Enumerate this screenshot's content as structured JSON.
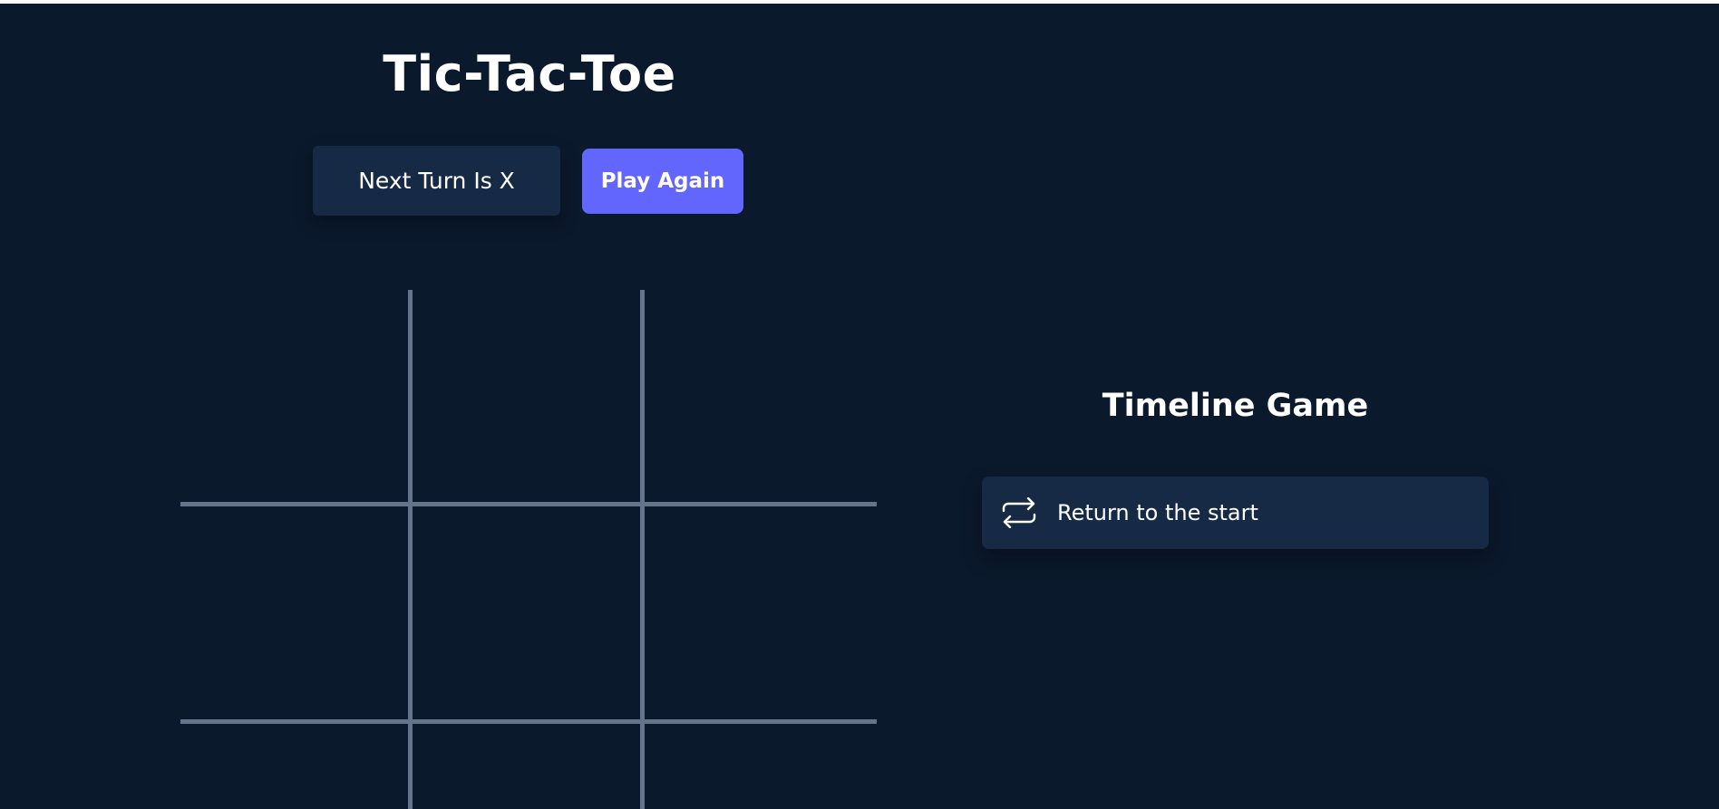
{
  "header": {
    "title": "Tic-Tac-Toe"
  },
  "status": {
    "next_turn_text": "Next Turn Is X"
  },
  "controls": {
    "play_again_label": "Play Again"
  },
  "board": {
    "cells": [
      "",
      "",
      "",
      "",
      "",
      "",
      "",
      "",
      ""
    ]
  },
  "timeline": {
    "title": "Timeline Game",
    "items": [
      {
        "label": "Return to the start",
        "icon": "repeat-icon"
      }
    ]
  },
  "colors": {
    "background": "#0b192c",
    "panel": "#172a45",
    "accent": "#6366fc",
    "grid_line": "#64748b",
    "text": "#ffffff"
  }
}
